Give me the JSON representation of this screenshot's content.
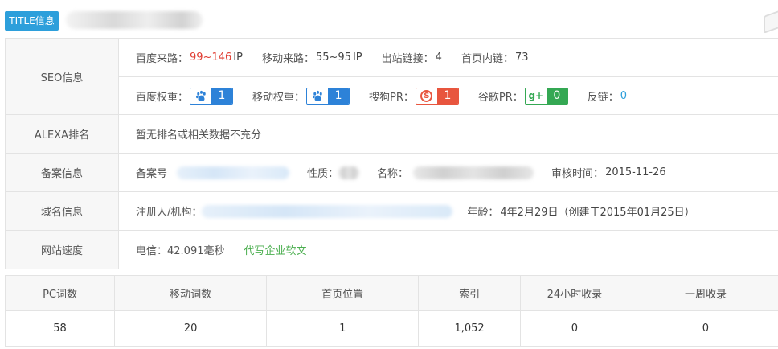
{
  "header": {
    "badge": "TITLE信息"
  },
  "seo": {
    "label": "SEO信息",
    "baidu_source": {
      "key": "百度来路：",
      "value": "99~146",
      "unit": " IP"
    },
    "mobile_source": {
      "key": "移动来路：",
      "value": "55~95",
      "unit": " IP"
    },
    "outbound_links": {
      "key": "出站链接：",
      "value": "4"
    },
    "home_internal": {
      "key": "首页内链：",
      "value": "73"
    },
    "baidu_weight": {
      "key": "百度权重：",
      "value": "1",
      "icon": "paw-icon"
    },
    "mobile_weight": {
      "key": "移动权重：",
      "value": "1",
      "icon": "paw-icon"
    },
    "sogou_pr": {
      "key": "搜狗PR：",
      "value": "1",
      "icon": "sogou-icon",
      "glyph": "S"
    },
    "google_pr": {
      "key": "谷歌PR：",
      "value": "0",
      "icon": "google-plus-icon",
      "glyph": "g+"
    },
    "backlinks": {
      "key": "反链：",
      "value": "0"
    }
  },
  "alexa": {
    "label": "ALEXA排名",
    "text": "暂无排名或相关数据不充分"
  },
  "icp": {
    "label": "备案信息",
    "number_key": "备案号",
    "nature_key": "性质：",
    "name_key": "名称：",
    "review_key": "审核时间：",
    "review_value": "2015-11-26"
  },
  "domain": {
    "label": "域名信息",
    "registrant_key": "注册人/机构：",
    "age_key": "年龄：",
    "age_value": "4年2月29日（创建于2015年01月25日）"
  },
  "speed": {
    "label": "网站速度",
    "telecom": "电信：42.091毫秒",
    "link": "代写企业软文"
  },
  "stats": {
    "headers": [
      "PC词数",
      "移动词数",
      "首页位置",
      "索引",
      "24小时收录",
      "一周收录"
    ],
    "values": [
      "58",
      "20",
      "1",
      "1,052",
      "0",
      "0"
    ]
  },
  "colors": {
    "accent_blue": "#2d9fdb",
    "red": "#e03c31",
    "green": "#4caf50"
  }
}
